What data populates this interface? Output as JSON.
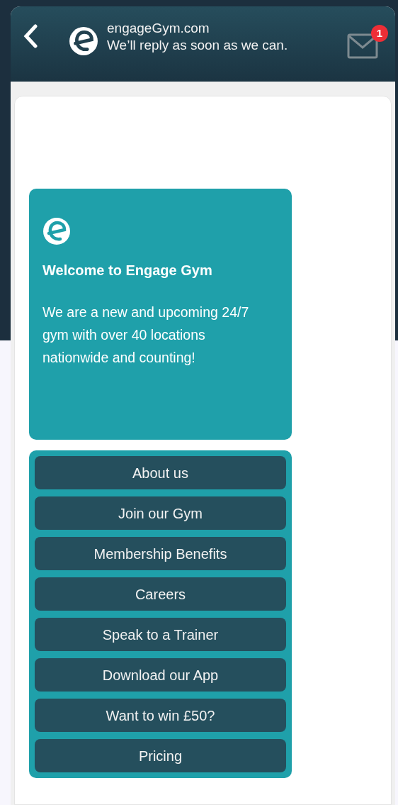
{
  "header": {
    "title": "engageGym.com",
    "subtitle": "We’ll reply as soon as we can.",
    "unread_badge": "1"
  },
  "welcome_card": {
    "title": "Welcome to Engage Gym",
    "body": "We are a new and upcoming 24/7 gym with over 40 locations nationwide and counting!"
  },
  "menu_buttons": [
    "About us",
    "Join our Gym",
    "Membership Benefits",
    "Careers",
    "Speak to a Trainer",
    "Download our App",
    "Want to win £50?",
    "Pricing"
  ]
}
